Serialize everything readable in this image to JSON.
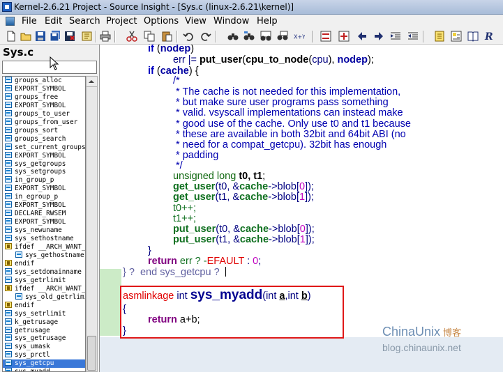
{
  "window": {
    "title": "Kernel-2.6.21 Project - Source Insight - [Sys.c (linux-2.6.21\\kernel)]"
  },
  "menu": [
    {
      "label": "File"
    },
    {
      "label": "Edit"
    },
    {
      "label": "Search"
    },
    {
      "label": "Project"
    },
    {
      "label": "Options"
    },
    {
      "label": "View"
    },
    {
      "label": "Window"
    },
    {
      "label": "Help"
    }
  ],
  "symbol_window": {
    "file_title": "Sys.c",
    "search_value": "",
    "items": [
      {
        "label": "groups_alloc",
        "icon": "symbol-icon"
      },
      {
        "label": "EXPORT_SYMBOL",
        "icon": "symbol-icon"
      },
      {
        "label": "groups_free",
        "icon": "symbol-icon"
      },
      {
        "label": "EXPORT_SYMBOL",
        "icon": "symbol-icon"
      },
      {
        "label": "groups_to_user",
        "icon": "symbol-icon"
      },
      {
        "label": "groups_from_user",
        "icon": "symbol-icon"
      },
      {
        "label": "groups_sort",
        "icon": "symbol-icon"
      },
      {
        "label": "groups_search",
        "icon": "symbol-icon"
      },
      {
        "label": "set_current_groups",
        "icon": "symbol-icon"
      },
      {
        "label": "EXPORT_SYMBOL",
        "icon": "symbol-icon"
      },
      {
        "label": "sys_getgroups",
        "icon": "symbol-icon"
      },
      {
        "label": "sys_setgroups",
        "icon": "symbol-icon"
      },
      {
        "label": "in_group_p",
        "icon": "symbol-icon"
      },
      {
        "label": "EXPORT_SYMBOL",
        "icon": "symbol-icon"
      },
      {
        "label": "in_egroup_p",
        "icon": "symbol-icon"
      },
      {
        "label": "EXPORT_SYMBOL",
        "icon": "symbol-icon"
      },
      {
        "label": "DECLARE_RWSEM",
        "icon": "symbol-icon"
      },
      {
        "label": "EXPORT_SYMBOL",
        "icon": "symbol-icon"
      },
      {
        "label": "sys_newuname",
        "icon": "symbol-icon"
      },
      {
        "label": "sys_sethostname",
        "icon": "symbol-icon"
      },
      {
        "label": "ifdef __ARCH_WANT_SYS_GETHOSTNAME",
        "icon": "conditional-icon"
      },
      {
        "label": "sys_gethostname",
        "icon": "symbol-icon",
        "indent": true
      },
      {
        "label": "endif",
        "icon": "conditional-icon"
      },
      {
        "label": "sys_setdomainname",
        "icon": "symbol-icon"
      },
      {
        "label": "sys_getrlimit",
        "icon": "symbol-icon"
      },
      {
        "label": "ifdef __ARCH_WANT_SYS_OLD_GETRLIMIT",
        "icon": "conditional-icon"
      },
      {
        "label": "sys_old_getrlimit",
        "icon": "symbol-icon",
        "indent": true
      },
      {
        "label": "endif",
        "icon": "conditional-icon"
      },
      {
        "label": "sys_setrlimit",
        "icon": "symbol-icon"
      },
      {
        "label": "k_getrusage",
        "icon": "symbol-icon"
      },
      {
        "label": "getrusage",
        "icon": "symbol-icon"
      },
      {
        "label": "sys_getrusage",
        "icon": "symbol-icon"
      },
      {
        "label": "sys_umask",
        "icon": "symbol-icon"
      },
      {
        "label": "sys_prctl",
        "icon": "symbol-icon"
      },
      {
        "label": "sys_getcpu",
        "icon": "symbol-icon",
        "selected": true
      },
      {
        "label": "sys_myadd",
        "icon": "symbol-icon"
      }
    ]
  },
  "code": {
    "l1_kw": "if",
    "l1_rest": " (",
    "l1_id": "nodep",
    "l1_end": ")",
    "l2_a": "err |= ",
    "l2_fn": "put_user",
    "l2_b": "(",
    "l2_fn2": "cpu_to_node",
    "l2_c": "(",
    "l2_d": "cpu",
    "l2_e": "), ",
    "l2_id": "nodep",
    "l2_f": ");",
    "l3_kw": "if",
    "l3_rest": " (",
    "l3_id": "cache",
    "l3_end": ") {",
    "c1": "/*",
    "c2": " * The cache is not needed for this implementation,",
    "c3": " * but make sure user programs pass something",
    "c4": " * valid. vsyscall implementations can instead make",
    "c5": " * good use of the cache. Only use t0 and t1 because",
    "c6": " * these are available in both 32bit and 64bit ABI (no",
    "c7": " * need for a compat_getcpu). 32bit has enough",
    "c8": " * padding",
    "c9": " */",
    "decl_type": "unsigned long ",
    "decl_vars": "t0, t1",
    "decl_end": ";",
    "gu1_fn": "get_user",
    "gu1_a": "(t0, &",
    "gu1_id": "cache",
    "gu1_b": "->blob[",
    "gu1_n": "0",
    "gu1_c": "]);",
    "gu2_fn": "get_user",
    "gu2_a": "(t1, &",
    "gu2_id": "cache",
    "gu2_b": "->blob[",
    "gu2_n": "1",
    "gu2_c": "]);",
    "inc1": "t0++;",
    "inc2": "t1++;",
    "pu1_fn": "put_user",
    "pu1_a": "(t0, &",
    "pu1_id": "cache",
    "pu1_b": "->blob[",
    "pu1_n": "0",
    "pu1_c": "]);",
    "pu2_fn": "put_user",
    "pu2_a": "(t1, &",
    "pu2_id": "cache",
    "pu2_b": "->blob[",
    "pu2_n": "1",
    "pu2_c": "]);",
    "close_inner": "}",
    "ret_kw": "return",
    "ret_a": " err ? -",
    "ret_b": "EFAULT",
    "ret_c": " : ",
    "ret_n": "0",
    "ret_d": ";",
    "close_fn": "} ?  end sys_getcpu ?",
    "new_sig_a": "asmlinkage ",
    "new_sig_b": "int ",
    "new_sig_fn": "sys_myadd",
    "new_sig_c": "(int ",
    "new_sig_p1": "a",
    "new_sig_d": ",int ",
    "new_sig_p2": "b",
    "new_sig_e": ")",
    "new_open": "{",
    "new_ret_kw": "return",
    "new_ret_body": " a+b;",
    "new_close": "}"
  },
  "watermark": {
    "brand": "ChinaUnix",
    "brand_cn": "博客",
    "url": "blog.chinaunix.net"
  },
  "colors": {
    "highlight_box": "#e01818",
    "selection": "#3a78d8",
    "gutter_changed": "#ccebc7"
  }
}
